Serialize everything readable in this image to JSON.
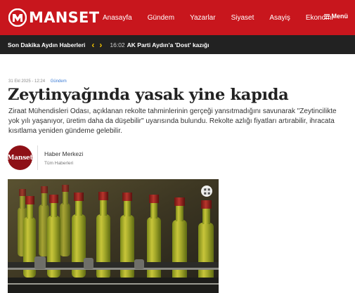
{
  "header": {
    "logo_text": "MANSET",
    "nav": [
      "Anasayfa",
      "Gündem",
      "Yazarlar",
      "Siyaset",
      "Asayiş",
      "Ekonomi"
    ],
    "menu_label": "Menü",
    "brand_color": "#c8161d"
  },
  "breaking": {
    "label": "Son Dakika Aydın Haberleri",
    "time": "16:02",
    "text": "AK Parti Aydın'a 'Dost' kazığı"
  },
  "article": {
    "date": "31 Ekl 2025 - 12:24",
    "category": "Gündem",
    "title": "Zeytinyağında yasak yine kapıda",
    "summary": "Ziraat Mühendisleri Odası, açıklanan rekolte tahminlerinin gerçeği yansıtmadığını savunarak \"Zeytincilikte yok yılı yaşanıyor, üretim daha da düşebilir\" uyarısında bulundu. Rekolte azlığı fiyatları artırabilir, ihracata kısıtlama yeniden gündeme gelebilir."
  },
  "author": {
    "avatar_text": "Manset",
    "name": "Haber Merkezi",
    "link": "Tüm Haberleri"
  },
  "image": {
    "subject": "olive-oil-bottles-on-conveyor",
    "expand_icon": "expand-icon"
  }
}
